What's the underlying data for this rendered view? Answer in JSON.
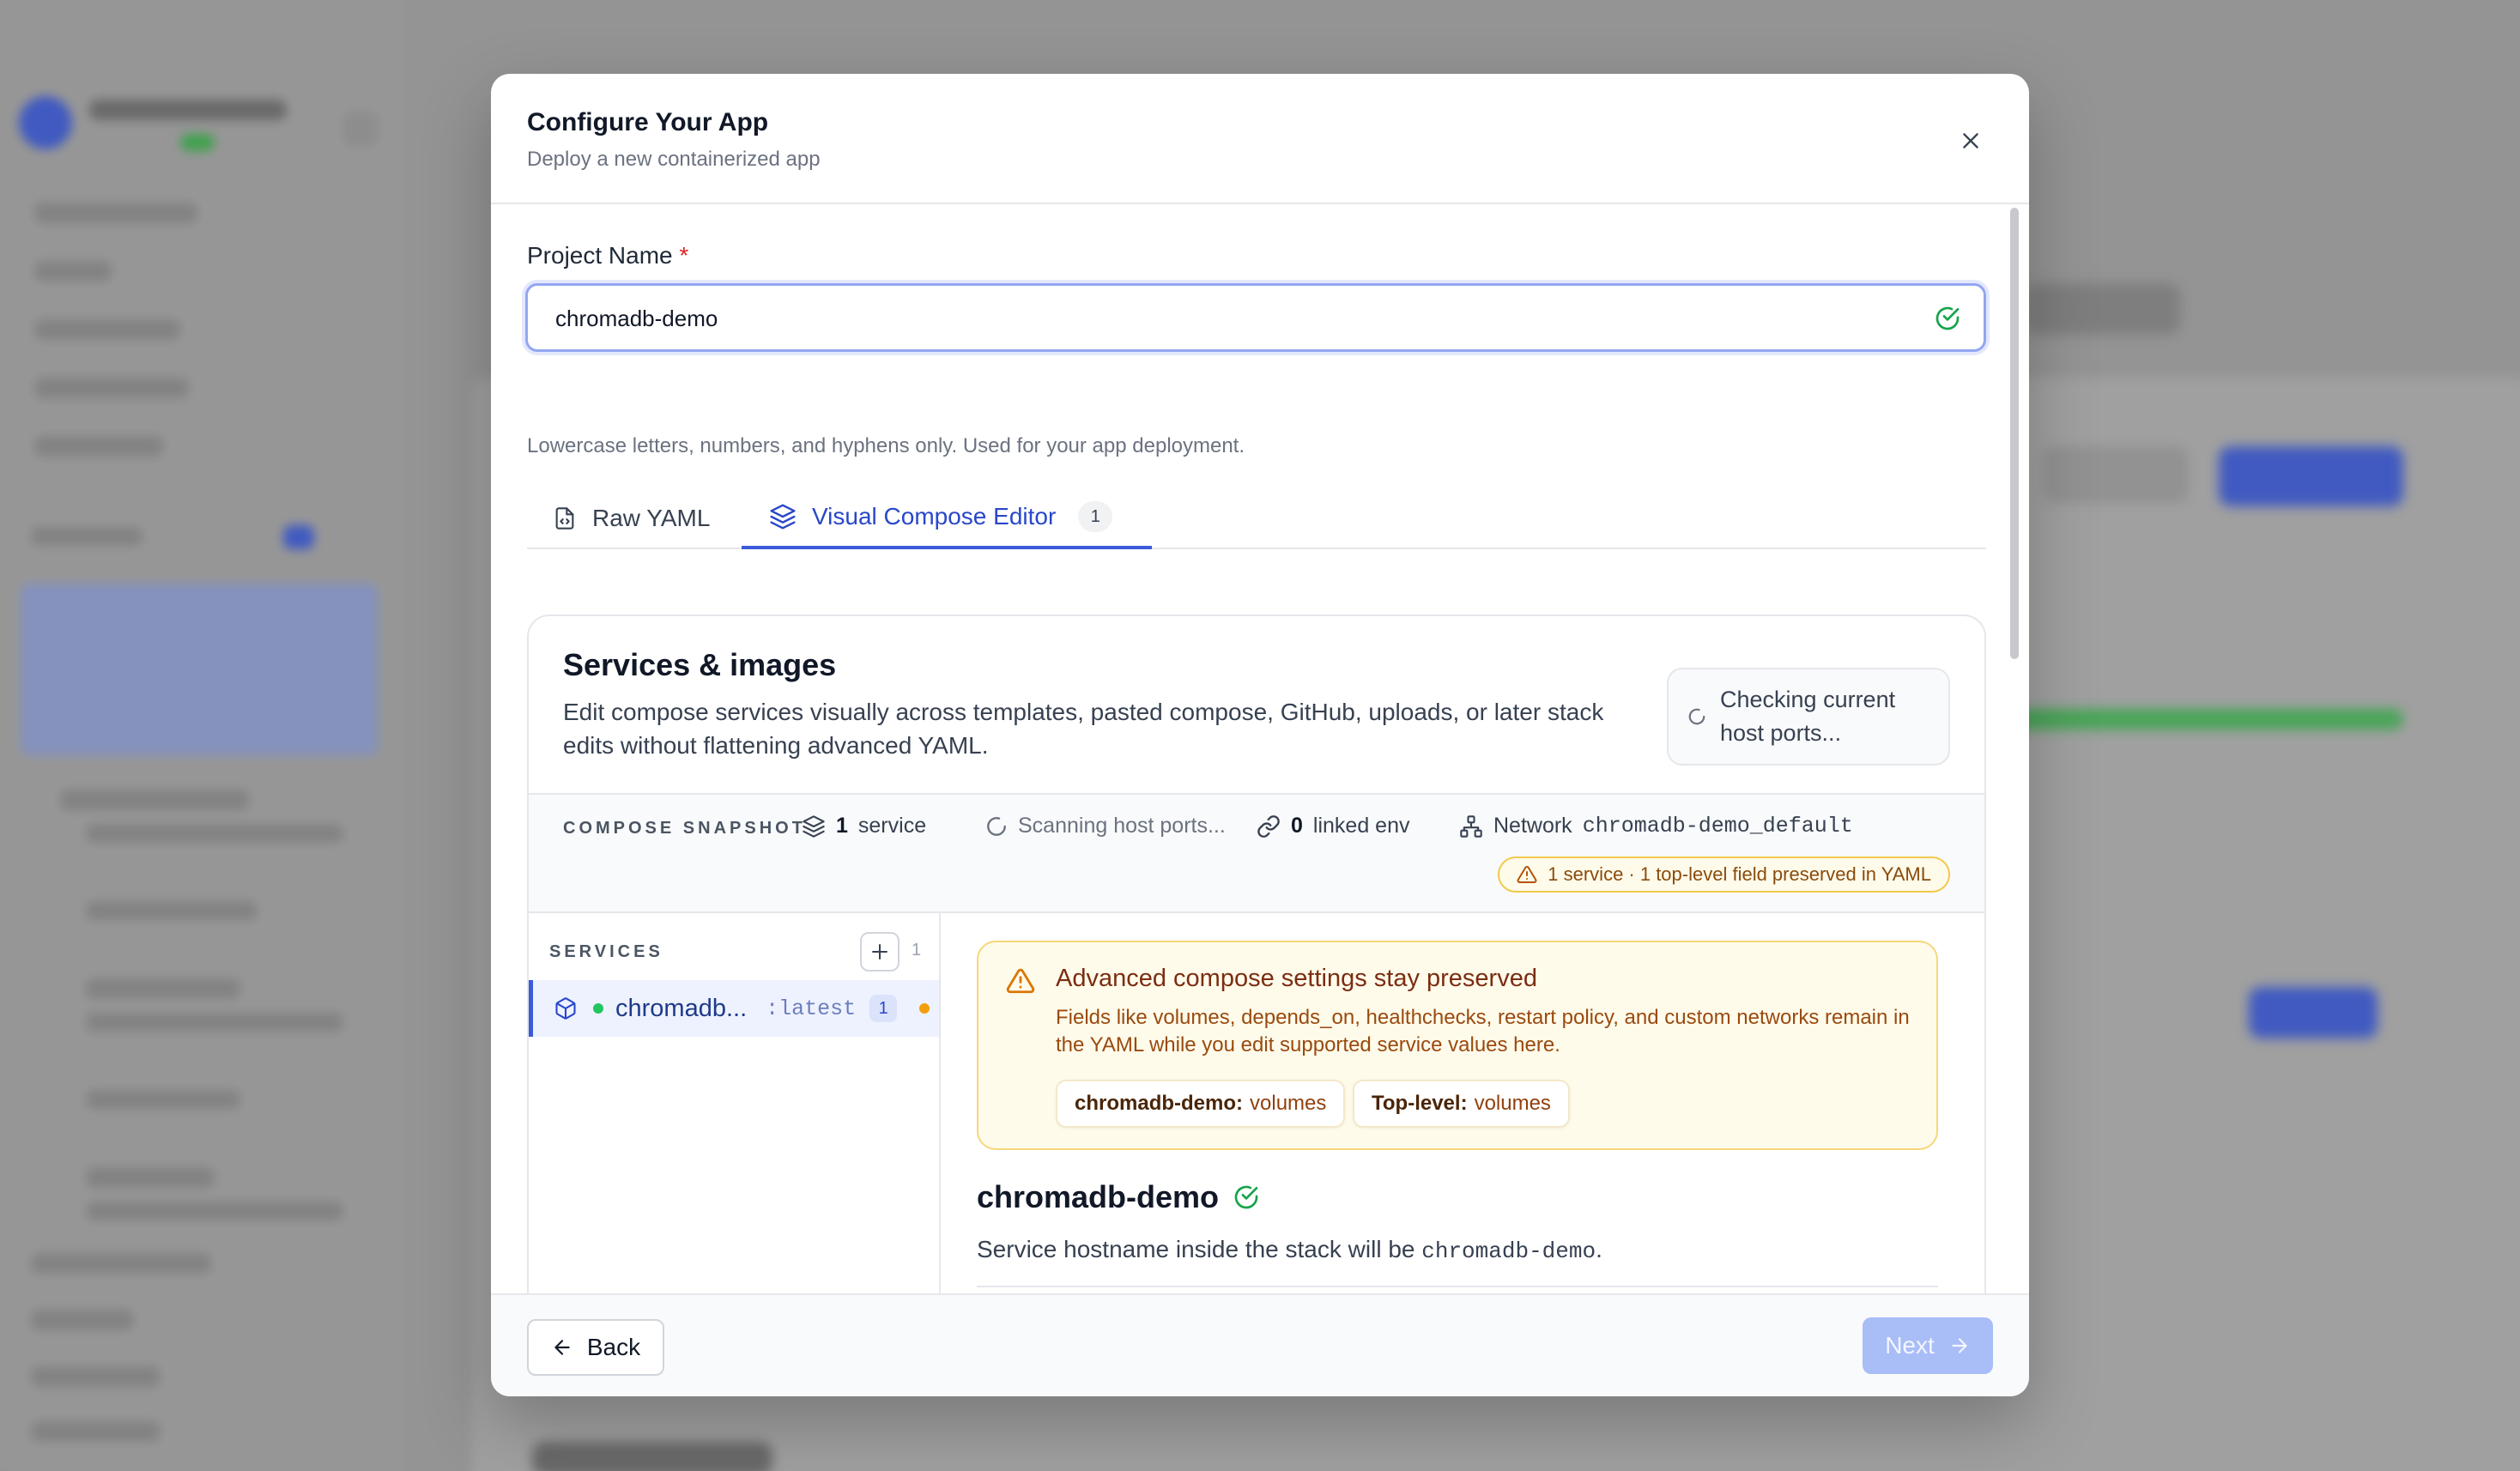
{
  "modal": {
    "title": "Configure Your App",
    "subtitle": "Deploy a new containerized app"
  },
  "project_name": {
    "label": "Project Name",
    "required_mark": "*",
    "value": "chromadb-demo",
    "hint": "Lowercase letters, numbers, and hyphens only. Used for your app deployment."
  },
  "tabs": [
    {
      "label": "Raw YAML",
      "icon": "file-code-icon",
      "active": false
    },
    {
      "label": "Visual Compose Editor",
      "icon": "layers-icon",
      "active": true,
      "badge": "1"
    }
  ],
  "services_card": {
    "title": "Services & images",
    "description": "Edit compose services visually across templates, pasted compose, GitHub, uploads, or later stack edits without flattening advanced YAML.",
    "checking_label": "Checking current host ports..."
  },
  "snapshot": {
    "label": "COMPOSE SNAPSHOT",
    "service_count": "1",
    "service_word": "service",
    "scanning": "Scanning host ports...",
    "linked_env_count": "0",
    "linked_env_word": "linked env",
    "network_word": "Network",
    "network_name": "chromadb-demo_default",
    "warning": "1 service · 1 top-level field preserved in YAML"
  },
  "services_list": {
    "label": "SERVICES",
    "count": "1",
    "items": [
      {
        "name": "chromadb...",
        "tag": ":latest",
        "badge": "1"
      }
    ]
  },
  "advisory": {
    "title": "Advanced compose settings stay preserved",
    "text": "Fields like volumes, depends_on, healthchecks, restart policy, and custom networks remain in the YAML while you edit supported service values here.",
    "chips": [
      {
        "key": "chromadb-demo:",
        "value": "volumes"
      },
      {
        "key": "Top-level:",
        "value": "volumes"
      }
    ]
  },
  "service_detail": {
    "name": "chromadb-demo",
    "hostname_prefix": "Service hostname inside the stack will be",
    "hostname": "chromadb-demo",
    "hostname_suffix": "."
  },
  "footer": {
    "back_label": "Back",
    "next_label": "Next"
  },
  "colors": {
    "accent": "#3b5bdb",
    "success": "#16a34a",
    "warning": "#d97706",
    "next_disabled": "#a9bdf7"
  }
}
